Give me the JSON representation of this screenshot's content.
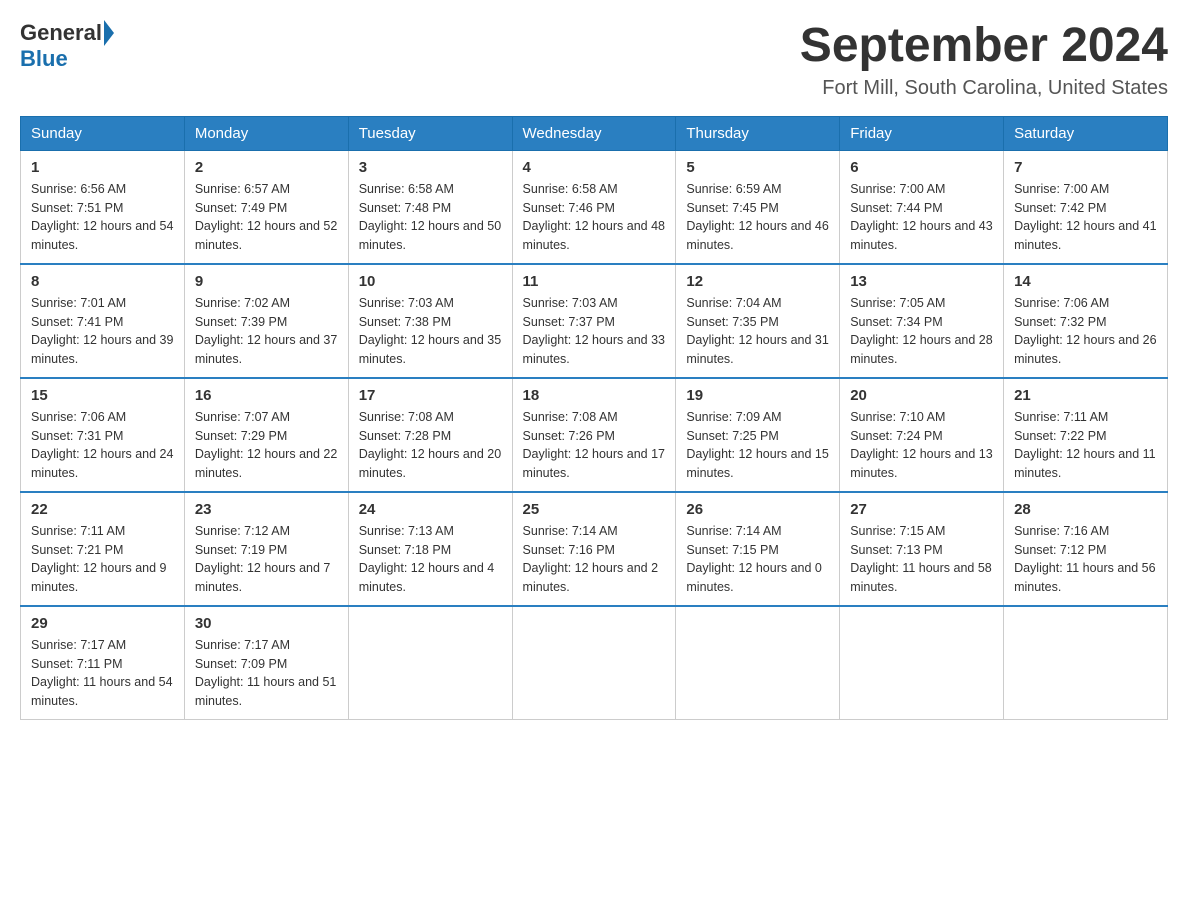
{
  "logo": {
    "general": "General",
    "blue": "Blue"
  },
  "title": "September 2024",
  "location": "Fort Mill, South Carolina, United States",
  "weekdays": [
    "Sunday",
    "Monday",
    "Tuesday",
    "Wednesday",
    "Thursday",
    "Friday",
    "Saturday"
  ],
  "weeks": [
    [
      {
        "day": "1",
        "sunrise": "6:56 AM",
        "sunset": "7:51 PM",
        "daylight": "12 hours and 54 minutes."
      },
      {
        "day": "2",
        "sunrise": "6:57 AM",
        "sunset": "7:49 PM",
        "daylight": "12 hours and 52 minutes."
      },
      {
        "day": "3",
        "sunrise": "6:58 AM",
        "sunset": "7:48 PM",
        "daylight": "12 hours and 50 minutes."
      },
      {
        "day": "4",
        "sunrise": "6:58 AM",
        "sunset": "7:46 PM",
        "daylight": "12 hours and 48 minutes."
      },
      {
        "day": "5",
        "sunrise": "6:59 AM",
        "sunset": "7:45 PM",
        "daylight": "12 hours and 46 minutes."
      },
      {
        "day": "6",
        "sunrise": "7:00 AM",
        "sunset": "7:44 PM",
        "daylight": "12 hours and 43 minutes."
      },
      {
        "day": "7",
        "sunrise": "7:00 AM",
        "sunset": "7:42 PM",
        "daylight": "12 hours and 41 minutes."
      }
    ],
    [
      {
        "day": "8",
        "sunrise": "7:01 AM",
        "sunset": "7:41 PM",
        "daylight": "12 hours and 39 minutes."
      },
      {
        "day": "9",
        "sunrise": "7:02 AM",
        "sunset": "7:39 PM",
        "daylight": "12 hours and 37 minutes."
      },
      {
        "day": "10",
        "sunrise": "7:03 AM",
        "sunset": "7:38 PM",
        "daylight": "12 hours and 35 minutes."
      },
      {
        "day": "11",
        "sunrise": "7:03 AM",
        "sunset": "7:37 PM",
        "daylight": "12 hours and 33 minutes."
      },
      {
        "day": "12",
        "sunrise": "7:04 AM",
        "sunset": "7:35 PM",
        "daylight": "12 hours and 31 minutes."
      },
      {
        "day": "13",
        "sunrise": "7:05 AM",
        "sunset": "7:34 PM",
        "daylight": "12 hours and 28 minutes."
      },
      {
        "day": "14",
        "sunrise": "7:06 AM",
        "sunset": "7:32 PM",
        "daylight": "12 hours and 26 minutes."
      }
    ],
    [
      {
        "day": "15",
        "sunrise": "7:06 AM",
        "sunset": "7:31 PM",
        "daylight": "12 hours and 24 minutes."
      },
      {
        "day": "16",
        "sunrise": "7:07 AM",
        "sunset": "7:29 PM",
        "daylight": "12 hours and 22 minutes."
      },
      {
        "day": "17",
        "sunrise": "7:08 AM",
        "sunset": "7:28 PM",
        "daylight": "12 hours and 20 minutes."
      },
      {
        "day": "18",
        "sunrise": "7:08 AM",
        "sunset": "7:26 PM",
        "daylight": "12 hours and 17 minutes."
      },
      {
        "day": "19",
        "sunrise": "7:09 AM",
        "sunset": "7:25 PM",
        "daylight": "12 hours and 15 minutes."
      },
      {
        "day": "20",
        "sunrise": "7:10 AM",
        "sunset": "7:24 PM",
        "daylight": "12 hours and 13 minutes."
      },
      {
        "day": "21",
        "sunrise": "7:11 AM",
        "sunset": "7:22 PM",
        "daylight": "12 hours and 11 minutes."
      }
    ],
    [
      {
        "day": "22",
        "sunrise": "7:11 AM",
        "sunset": "7:21 PM",
        "daylight": "12 hours and 9 minutes."
      },
      {
        "day": "23",
        "sunrise": "7:12 AM",
        "sunset": "7:19 PM",
        "daylight": "12 hours and 7 minutes."
      },
      {
        "day": "24",
        "sunrise": "7:13 AM",
        "sunset": "7:18 PM",
        "daylight": "12 hours and 4 minutes."
      },
      {
        "day": "25",
        "sunrise": "7:14 AM",
        "sunset": "7:16 PM",
        "daylight": "12 hours and 2 minutes."
      },
      {
        "day": "26",
        "sunrise": "7:14 AM",
        "sunset": "7:15 PM",
        "daylight": "12 hours and 0 minutes."
      },
      {
        "day": "27",
        "sunrise": "7:15 AM",
        "sunset": "7:13 PM",
        "daylight": "11 hours and 58 minutes."
      },
      {
        "day": "28",
        "sunrise": "7:16 AM",
        "sunset": "7:12 PM",
        "daylight": "11 hours and 56 minutes."
      }
    ],
    [
      {
        "day": "29",
        "sunrise": "7:17 AM",
        "sunset": "7:11 PM",
        "daylight": "11 hours and 54 minutes."
      },
      {
        "day": "30",
        "sunrise": "7:17 AM",
        "sunset": "7:09 PM",
        "daylight": "11 hours and 51 minutes."
      },
      null,
      null,
      null,
      null,
      null
    ]
  ]
}
